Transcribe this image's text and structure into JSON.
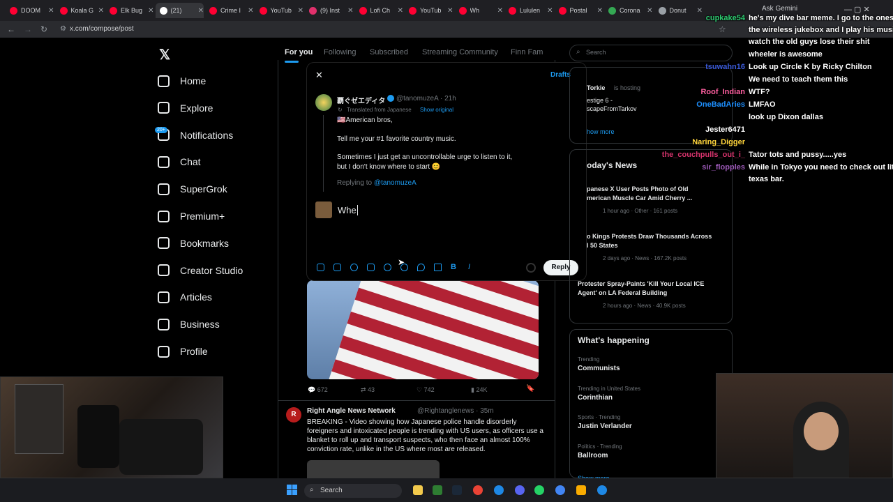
{
  "browser": {
    "tabs": [
      {
        "label": "DOOM",
        "color": "#ff0033"
      },
      {
        "label": "Koala G",
        "color": "#ff0033"
      },
      {
        "label": "Elk Bug",
        "color": "#ff0033"
      },
      {
        "label": "(21)",
        "color": "#ffffff"
      },
      {
        "label": "Crime I",
        "color": "#ff0033"
      },
      {
        "label": "YouTub",
        "color": "#ff0033"
      },
      {
        "label": "(9) Inst",
        "color": "#e1306c"
      },
      {
        "label": "Lofi Ch",
        "color": "#ff0033"
      },
      {
        "label": "YouTub",
        "color": "#ff0033"
      },
      {
        "label": "Wh",
        "color": "#ff0033"
      },
      {
        "label": "Lululen",
        "color": "#ff0033"
      },
      {
        "label": "Postal",
        "color": "#ff0033"
      },
      {
        "label": "Corona",
        "color": "#34a853"
      },
      {
        "label": "Donut",
        "color": "#9aa0a6"
      }
    ],
    "url": "x.com/compose/post",
    "ask_gemini": "Ask Gemini"
  },
  "nav": {
    "items": [
      {
        "label": "Home",
        "icon": "home-icon"
      },
      {
        "label": "Explore",
        "icon": "search-icon"
      },
      {
        "label": "Notifications",
        "icon": "bell-icon"
      },
      {
        "label": "Chat",
        "icon": "mail-icon"
      },
      {
        "label": "SuperGrok",
        "icon": "grok-icon"
      },
      {
        "label": "Premium+",
        "icon": "verified-icon"
      },
      {
        "label": "Bookmarks",
        "icon": "bookmark-icon"
      },
      {
        "label": "Creator Studio",
        "icon": "rocket-icon"
      },
      {
        "label": "Articles",
        "icon": "article-icon"
      },
      {
        "label": "Business",
        "icon": "lightning-icon"
      },
      {
        "label": "Profile",
        "icon": "person-icon"
      }
    ],
    "notif_badge": "20+"
  },
  "feed": {
    "tabs": [
      "For you",
      "Following",
      "Subscribed",
      "Streaming Community",
      "Finn Fam"
    ],
    "flag_stats": {
      "replies": "672",
      "reposts": "43",
      "likes": "742",
      "views": "24K"
    },
    "second_tweet": {
      "author": "Right Angle News Network",
      "handle": "@Rightanglenews · 35m",
      "text": "BREAKING - Video showing how Japanese police handle disorderly foreigners and intoxicated people is trending with US users, as officers use a blanket to roll up and transport suspects, who then face an almost 100% conviction rate, unlike in the US where most are released."
    }
  },
  "modal": {
    "drafts": "Drafts",
    "author": "覇ぐゼエディタ",
    "handle": "@tanomuzeA · 21h",
    "translated": "Translated from Japanese",
    "show_original": "Show original",
    "lines": [
      "🇺🇸American bros,",
      "Tell me your #1 favorite country music.",
      "Sometimes I just get an uncontrollable urge to listen to it,",
      "but I don't know where to start 😊"
    ],
    "replying_to_label": "Replying to",
    "replying_to": "@tanomuzeA",
    "input_value": "Whe",
    "reply_button": "Reply"
  },
  "right": {
    "search_placeholder": "Search",
    "hosting": {
      "name": "Torkie",
      "suffix": "is hosting",
      "title1": "estige 6 -",
      "title2": "scapeFromTarkov"
    },
    "show_more": "how more",
    "todays_news": "oday's News",
    "news": [
      {
        "t1": "panese X User Posts Photo of Old",
        "t2": "merican Muscle Car Amid Cherry ...",
        "meta": "1 hour ago · Other · 161 posts"
      },
      {
        "t1": "o Kings Protests Draw Thousands Across",
        "t2": "l 50 States",
        "meta": "2 days ago · News · 167.2K posts"
      },
      {
        "t1": "Protester Spray-Paints 'Kill Your Local ICE",
        "t2": "Agent' on LA Federal Building",
        "meta": "2 hours ago · News · 40.9K posts"
      }
    ],
    "whats_happening": "What's happening",
    "trends": [
      {
        "ctx": "Trending",
        "name": "Communists"
      },
      {
        "ctx": "Trending in United States",
        "name": "Corinthian"
      },
      {
        "ctx": "Sports · Trending",
        "name": "Justin Verlander"
      },
      {
        "ctx": "Politics · Trending",
        "name": "Ballroom"
      }
    ],
    "show_more2": "Show more"
  },
  "chat": [
    {
      "user": "cupkake54",
      "msg": "he's my dive bar meme. I go to the ones w",
      "ucolor": "#2ecc71"
    },
    {
      "user": "",
      "msg": "the wireless jukebox and I play his music",
      "ucolor": "#fff"
    },
    {
      "user": "",
      "msg": "watch the old guys lose their shit",
      "ucolor": "#fff"
    },
    {
      "user": "",
      "msg": "wheeler is awesome",
      "ucolor": "#fff"
    },
    {
      "user": "tsuwahn16",
      "msg": "Look up Circle K by Ricky Chilton",
      "ucolor": "#3b5bdb"
    },
    {
      "user": "",
      "msg": "We need to teach them this",
      "ucolor": "#fff"
    },
    {
      "user": "Roof_Indian",
      "msg": "WTF?",
      "ucolor": "#ff5fa0"
    },
    {
      "user": "OneBadAries",
      "msg": "LMFAO",
      "ucolor": "#1e90ff"
    },
    {
      "user": "",
      "msg": "look up Dixon dallas",
      "ucolor": "#fff"
    },
    {
      "user": "Jester6471",
      "msg": "",
      "ucolor": "#ffffff"
    },
    {
      "user": "Naring_Digger",
      "msg": "",
      "ucolor": "#ffd43b"
    },
    {
      "user": "the_couchpulls_out_i_",
      "msg": "Tator tots and pussy.....yes",
      "ucolor": "#d6336c"
    },
    {
      "user": "sir_flopples",
      "msg": "While in Tokyo you need to check out littl",
      "ucolor": "#9b59b6"
    },
    {
      "user": "",
      "msg": "texas bar.",
      "ucolor": "#fff"
    }
  ],
  "taskbar": {
    "search": "Search"
  }
}
